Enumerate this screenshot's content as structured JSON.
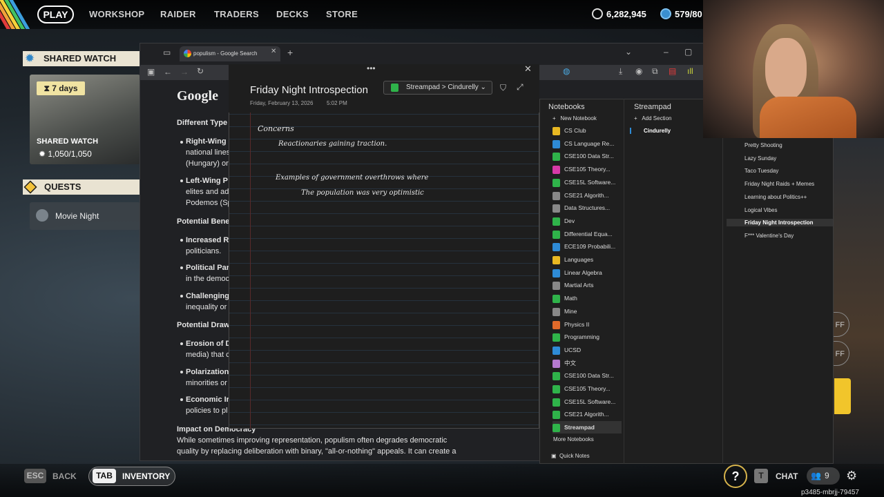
{
  "top_nav": {
    "items": [
      "PLAY",
      "WORKSHOP",
      "RAIDER",
      "TRADERS",
      "DECKS",
      "STORE"
    ],
    "currency1": "6,282,945",
    "currency2": "579/80"
  },
  "shared_watch": {
    "heading": "SHARED WATCH",
    "timer": "7 days",
    "card_title": "SHARED WATCH",
    "progress": "1,050/1,050"
  },
  "quests": {
    "heading": "QUESTS",
    "item": "Movie Night"
  },
  "browser": {
    "tab_title": "populism - Google Search",
    "logo": "Google",
    "headings": {
      "different_types": "Different Type",
      "potential_benefits": "Potential Bene",
      "potential_drawbacks": "Potential Draw",
      "impact": "Impact on Democracy"
    },
    "lines": {
      "right_wing": "Right-Wing",
      "right_wing_2": "national lines",
      "right_wing_3": "(Hungary) or",
      "left_wing": "Left-Wing P",
      "left_wing_2": "elites and ad",
      "left_wing_3": "Podemos (Sp",
      "increased": "Increased R",
      "increased_2": "politicians.",
      "political": "Political Par",
      "political_2": "in the democ",
      "challenging": "Challenging",
      "challenging_2": "inequality or",
      "erosion": "Erosion of D",
      "erosion_2": "media) that c",
      "polarization": "Polarization",
      "polarization_2": "minorities or",
      "economic": "Economic Ir",
      "economic_2": "policies to pl",
      "impact_text_1": "While sometimes improving representation, populism often degrades democratic",
      "impact_text_2": "quality by replacing deliberation with binary, \"all-or-nothing\" appeals. It can create a"
    }
  },
  "onenote": {
    "page_title": "Friday Night Introspection",
    "date": "Friday, February 13, 2026",
    "time": "5:02 PM",
    "breadcrumb": "Streampad > Cindurelly",
    "ink": {
      "line1": "Concerns",
      "line2": "Reactionaries gaining traction.",
      "line3": "Examples of government overthrows where",
      "line4": "The population was very optimistic"
    },
    "notebooks_header": "Notebooks",
    "new_notebook": "New Notebook",
    "notebooks": [
      {
        "name": "CS Club",
        "color": "#e8b822"
      },
      {
        "name": "CS Language Re...",
        "color": "#2e8bd6"
      },
      {
        "name": "CSE100 Data Str...",
        "color": "#2fb34a"
      },
      {
        "name": "CSE105 Theory...",
        "color": "#d63aa7"
      },
      {
        "name": "CSE15L Software...",
        "color": "#2fb34a"
      },
      {
        "name": "CSE21 Algorith...",
        "color": "#888888"
      },
      {
        "name": "Data Structures...",
        "color": "#888888"
      },
      {
        "name": "Dev",
        "color": "#2fb34a"
      },
      {
        "name": "Differential Equa...",
        "color": "#2fb34a"
      },
      {
        "name": "ECE109 Probabili...",
        "color": "#2e8bd6"
      },
      {
        "name": "Languages",
        "color": "#e8b822"
      },
      {
        "name": "Linear Algebra",
        "color": "#2e8bd6"
      },
      {
        "name": "Martial Arts",
        "color": "#888888"
      },
      {
        "name": "Math",
        "color": "#2fb34a"
      },
      {
        "name": "Mine",
        "color": "#888888"
      },
      {
        "name": "Physics II",
        "color": "#e06a2a"
      },
      {
        "name": "Programming",
        "color": "#2fb34a"
      },
      {
        "name": "UCSD",
        "color": "#2e8bd6"
      },
      {
        "name": "中文",
        "color": "#b57ad0"
      },
      {
        "name": "CSE100 Data Str...",
        "color": "#2fb34a"
      },
      {
        "name": "CSE105 Theory...",
        "color": "#2fb34a"
      },
      {
        "name": "CSE15L Software...",
        "color": "#2fb34a"
      },
      {
        "name": "CSE21 Algorith...",
        "color": "#2fb34a"
      },
      {
        "name": "Streampad",
        "color": "#2fb34a"
      }
    ],
    "more_notebooks": "More Notebooks",
    "quick_notes": "Quick Notes",
    "sections_header": "Streampad",
    "add_section": "Add Section",
    "section": "Cindurelly",
    "pages": [
      "Pretty Shooting",
      "Lazy Sunday",
      "Taco Tuesday",
      "Friday Night Raids + Memes",
      "Learning about Politics++",
      "Logical Vibes",
      "Friday Night Introspection",
      "F*** Valentine's Day"
    ]
  },
  "bottom": {
    "esc": "ESC",
    "back": "BACK",
    "tab": "TAB",
    "inventory": "INVENTORY",
    "help": "?",
    "t": "T",
    "chat": "CHAT",
    "players": "9",
    "session": "p3485-mbrjj-79457"
  }
}
